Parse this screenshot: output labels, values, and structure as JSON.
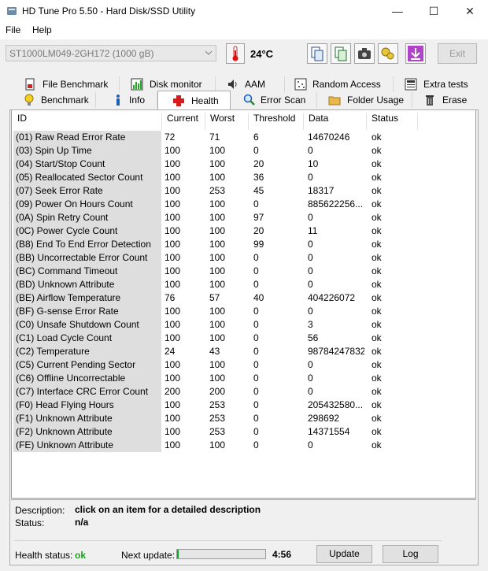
{
  "window": {
    "title": "HD Tune Pro 5.50 - Hard Disk/SSD Utility",
    "minimize": "—",
    "maximize": "☐",
    "close": "✕"
  },
  "menu": {
    "file": "File",
    "help": "Help"
  },
  "toolbar": {
    "drive": "ST1000LM049-2GH172 (1000 gB)",
    "temperature": "24°C",
    "exit_label": "Exit"
  },
  "tabs_top": [
    {
      "label": "File Benchmark",
      "icon": "file-benchmark-icon"
    },
    {
      "label": "Disk monitor",
      "icon": "disk-monitor-icon"
    },
    {
      "label": "AAM",
      "icon": "speaker-icon"
    },
    {
      "label": "Random Access",
      "icon": "random-access-icon"
    },
    {
      "label": "Extra tests",
      "icon": "extra-tests-icon"
    }
  ],
  "tabs_bottom": [
    {
      "label": "Benchmark",
      "icon": "benchmark-icon"
    },
    {
      "label": "Info",
      "icon": "info-icon"
    },
    {
      "label": "Health",
      "icon": "health-icon"
    },
    {
      "label": "Error Scan",
      "icon": "error-scan-icon"
    },
    {
      "label": "Folder Usage",
      "icon": "folder-icon"
    },
    {
      "label": "Erase",
      "icon": "erase-icon"
    }
  ],
  "active_tab": "Health",
  "table": {
    "headers": [
      "ID",
      "Current",
      "Worst",
      "Threshold",
      "Data",
      "Status"
    ],
    "rows": [
      [
        "(01) Raw Read Error Rate",
        "72",
        "71",
        "6",
        "14670246",
        "ok"
      ],
      [
        "(03) Spin Up Time",
        "100",
        "100",
        "0",
        "0",
        "ok"
      ],
      [
        "(04) Start/Stop Count",
        "100",
        "100",
        "20",
        "10",
        "ok"
      ],
      [
        "(05) Reallocated Sector Count",
        "100",
        "100",
        "36",
        "0",
        "ok"
      ],
      [
        "(07) Seek Error Rate",
        "100",
        "253",
        "45",
        "18317",
        "ok"
      ],
      [
        "(09) Power On Hours Count",
        "100",
        "100",
        "0",
        "885622256...",
        "ok"
      ],
      [
        "(0A) Spin Retry Count",
        "100",
        "100",
        "97",
        "0",
        "ok"
      ],
      [
        "(0C) Power Cycle Count",
        "100",
        "100",
        "20",
        "11",
        "ok"
      ],
      [
        "(B8) End To End Error Detection",
        "100",
        "100",
        "99",
        "0",
        "ok"
      ],
      [
        "(BB) Uncorrectable Error Count",
        "100",
        "100",
        "0",
        "0",
        "ok"
      ],
      [
        "(BC) Command Timeout",
        "100",
        "100",
        "0",
        "0",
        "ok"
      ],
      [
        "(BD) Unknown Attribute",
        "100",
        "100",
        "0",
        "0",
        "ok"
      ],
      [
        "(BE) Airflow Temperature",
        "76",
        "57",
        "40",
        "404226072",
        "ok"
      ],
      [
        "(BF) G-sense Error Rate",
        "100",
        "100",
        "0",
        "0",
        "ok"
      ],
      [
        "(C0) Unsafe Shutdown Count",
        "100",
        "100",
        "0",
        "3",
        "ok"
      ],
      [
        "(C1) Load Cycle Count",
        "100",
        "100",
        "0",
        "56",
        "ok"
      ],
      [
        "(C2) Temperature",
        "24",
        "43",
        "0",
        "98784247832",
        "ok"
      ],
      [
        "(C5) Current Pending Sector",
        "100",
        "100",
        "0",
        "0",
        "ok"
      ],
      [
        "(C6) Offline Uncorrectable",
        "100",
        "100",
        "0",
        "0",
        "ok"
      ],
      [
        "(C7) Interface CRC Error Count",
        "200",
        "200",
        "0",
        "0",
        "ok"
      ],
      [
        "(F0) Head Flying Hours",
        "100",
        "253",
        "0",
        "205432580...",
        "ok"
      ],
      [
        "(F1) Unknown Attribute",
        "100",
        "253",
        "0",
        "298692",
        "ok"
      ],
      [
        "(F2) Unknown Attribute",
        "100",
        "253",
        "0",
        "14371554",
        "ok"
      ],
      [
        "(FE) Unknown Attribute",
        "100",
        "100",
        "0",
        "0",
        "ok"
      ]
    ]
  },
  "details": {
    "description_label": "Description:",
    "description_value": "click on an item for a detailed description",
    "status_label": "Status:",
    "status_value": "n/a"
  },
  "footer": {
    "health_label": "Health status:",
    "health_value": "ok",
    "next_update_label": "Next update:",
    "next_update_time": "4:56",
    "progress_fraction": 0.02,
    "update_label": "Update",
    "log_label": "Log"
  },
  "colors": {
    "ok_green": "#1fa01f",
    "progress_green": "#06b025"
  }
}
